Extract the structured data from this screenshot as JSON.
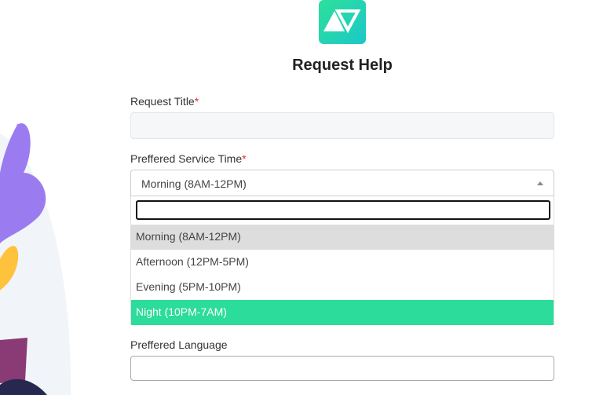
{
  "header": {
    "title": "Request Help",
    "logo": "triangles-logo"
  },
  "form": {
    "request_title": {
      "label": "Request Title",
      "required_mark": "*",
      "value": ""
    },
    "service_time": {
      "label": "Preffered Service Time",
      "required_mark": "*",
      "selected": "Morning (8AM-12PM)",
      "search_value": "",
      "options": [
        "Morning (8AM-12PM)",
        "Afternoon (12PM-5PM)",
        "Evening (5PM-10PM)",
        "Night (10PM-7AM)"
      ],
      "highlighted": "Night (10PM-7AM)"
    },
    "language": {
      "label": "Preffered Language",
      "value": ""
    }
  },
  "colors": {
    "accent": "#2bdc9b",
    "required": "#e0283a"
  }
}
